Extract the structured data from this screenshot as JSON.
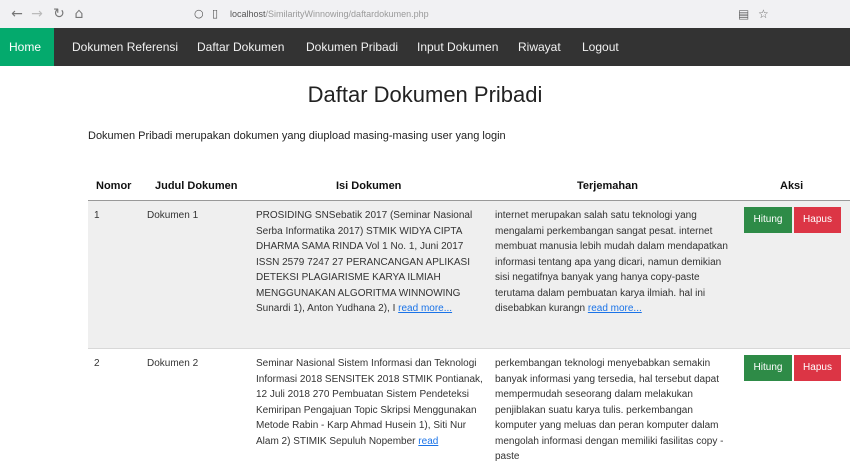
{
  "browser": {
    "url_host": "localhost",
    "url_path": "/SimilarityWinnowing/daftardokumen.php"
  },
  "nav": {
    "items": [
      {
        "label": "Home"
      },
      {
        "label": "Dokumen Referensi"
      },
      {
        "label": "Daftar Dokumen"
      },
      {
        "label": "Dokumen Pribadi"
      },
      {
        "label": "Input Dokumen"
      },
      {
        "label": "Riwayat"
      },
      {
        "label": "Logout"
      }
    ],
    "active_color": "#04aa6d",
    "bar_color": "#333333"
  },
  "page": {
    "title": "Daftar Dokumen Pribadi",
    "intro": "Dokumen Pribadi merupakan dokumen yang diupload masing-masing user yang login"
  },
  "table": {
    "headers": [
      "Nomor",
      "Judul Dokumen",
      "Isi Dokumen",
      "Terjemahan",
      "Aksi"
    ],
    "rows": [
      {
        "nomor": "1",
        "judul": "Dokumen 1",
        "isi": "PROSIDING SNSebatik 2017 (Seminar Nasional Serba Informatika 2017) STMIK WIDYA CIPTA DHARMA SAMA RINDA Vol 1 No. 1, Juni 2017 ISSN 2579 7247 27 PERANCANGAN APLIKASI DETEKSI PLAGIARISME KARYA ILMIAH MENGGUNAKAN ALGORITMA WINNOWING Sunardi 1), Anton Yudhana 2), I",
        "isi_more": "read more...",
        "terjemahan": "internet merupakan salah satu teknologi yang mengalami perkembangan sangat pesat. internet membuat manusia lebih mudah dalam mendapatkan informasi tentang apa yang dicari, namun demikian sisi negatifnya banyak yang hanya copy-paste terutama dalam pembuatan karya ilmiah. hal ini disebabkan kurangn",
        "terjemahan_more": "read more...",
        "btn_hitung": "Hitung",
        "btn_hapus": "Hapus"
      },
      {
        "nomor": "2",
        "judul": "Dokumen 2",
        "isi": "Seminar Nasional Sistem Informasi dan Teknologi Informasi 2018 SENSITEK 2018 STMIK Pontianak, 12 Juli 2018 270 Pembuatan Sistem Pendeteksi Kemiripan Pengajuan Topic Skripsi Menggunakan Metode Rabin - Karp Ahmad Husein 1), Siti Nur Alam 2) STIMIK Sepuluh Nopember",
        "isi_more": "read",
        "terjemahan": "perkembangan teknologi menyebabkan semakin banyak informasi yang tersedia, hal tersebut dapat mempermudah seseorang dalam melakukan penjiblakan suatu karya tulis. perkembangan komputer yang meluas dan peran komputer dalam mengolah informasi dengan memiliki fasilitas copy -paste",
        "btn_hitung": "Hitung",
        "btn_hapus": "Hapus"
      }
    ]
  },
  "colors": {
    "hitung": "#2e8b47",
    "hapus": "#dc3545",
    "link": "#1a73e8"
  }
}
